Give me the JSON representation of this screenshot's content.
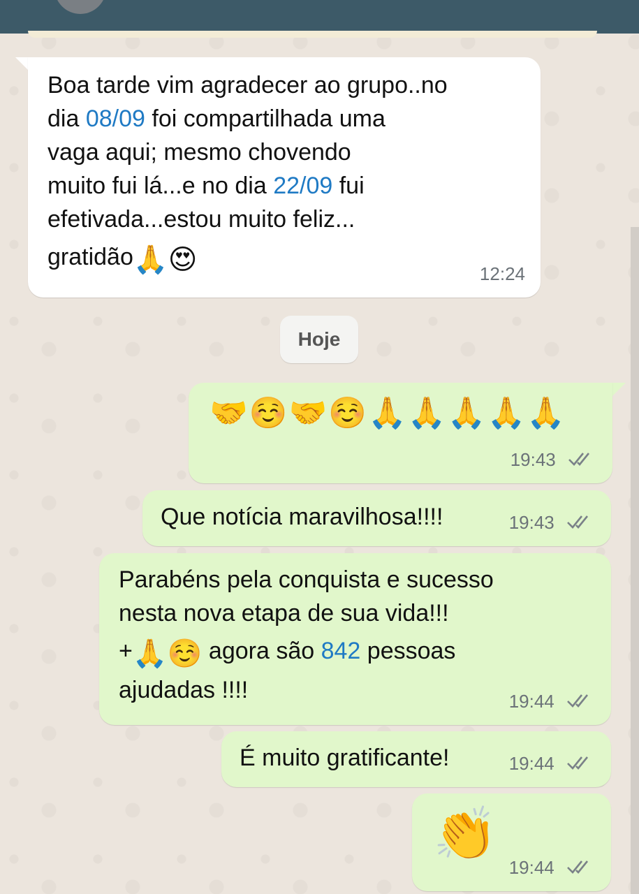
{
  "date_divider": "Hoje",
  "messages": [
    {
      "direction": "incoming",
      "lines": [
        [
          "Boa tarde vim agradecer ao grupo..no"
        ],
        [
          "dia ",
          "08/09",
          " foi compartilhada uma"
        ],
        [
          "vaga aqui; mesmo chovendo"
        ],
        [
          "muito fui lá...e no dia ",
          "22/09",
          " fui"
        ],
        [
          "efetivada...estou muito feliz..."
        ],
        [
          "gratidão",
          "🙏",
          "😍"
        ]
      ],
      "time": "12:24"
    },
    {
      "direction": "outgoing",
      "emojis": "🤝☺️🤝☺️🙏🙏🙏🙏🙏",
      "time": "19:43",
      "status": "read-ticks"
    },
    {
      "direction": "outgoing",
      "text": "Que notícia maravilhosa!!!!",
      "time": "19:43",
      "status": "read-ticks"
    },
    {
      "direction": "outgoing",
      "lines": [
        [
          "Parabéns pela conquista e sucesso"
        ],
        [
          "nesta nova etapa de sua vida!!!"
        ],
        [
          "+",
          "🙏",
          "☺️",
          " agora são ",
          "842",
          " pessoas"
        ],
        [
          "ajudadas !!!!"
        ]
      ],
      "time": "19:44",
      "status": "read-ticks"
    },
    {
      "direction": "outgoing",
      "text": "É muito gratificante!",
      "time": "19:44",
      "status": "read-ticks"
    },
    {
      "direction": "outgoing",
      "emojis": "👏",
      "time": "19:44",
      "status": "read-ticks"
    }
  ],
  "colors": {
    "header": "#3d5a68",
    "chat_background": "#ece5dd",
    "incoming_bubble": "#ffffff",
    "outgoing_bubble": "#e1f7cb",
    "link": "#1f7ac4",
    "timestamp": "#6b7278"
  }
}
